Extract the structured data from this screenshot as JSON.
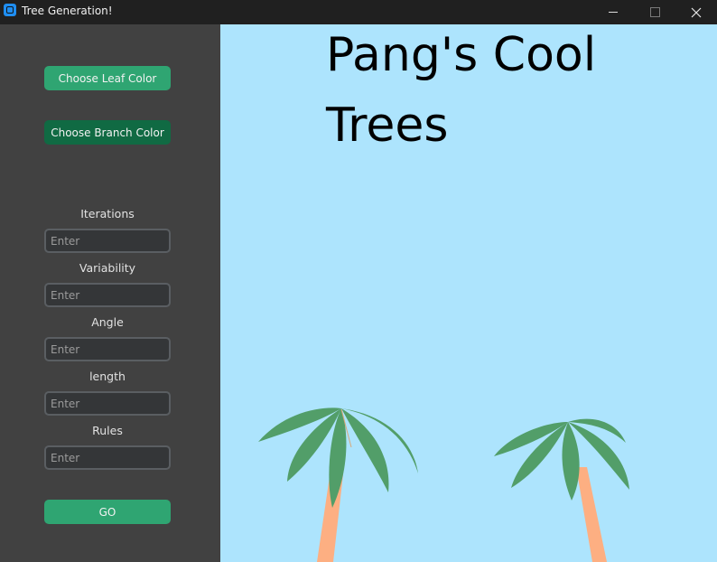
{
  "window": {
    "title": "Tree Generation!",
    "controls": {
      "minimize": "—",
      "maximize": "☐",
      "close": "✕"
    }
  },
  "sidebar": {
    "leaf_color_button": "Choose Leaf Color",
    "branch_color_button": "Choose Branch Color",
    "fields": [
      {
        "label": "Iterations",
        "placeholder": "Enter",
        "value": ""
      },
      {
        "label": "Variability",
        "placeholder": "Enter",
        "value": ""
      },
      {
        "label": "Angle",
        "placeholder": "Enter",
        "value": ""
      },
      {
        "label": "length",
        "placeholder": "Enter",
        "value": ""
      },
      {
        "label": "Rules",
        "placeholder": "Enter",
        "value": ""
      }
    ],
    "go_button": "GO"
  },
  "canvas": {
    "heading": "Pang's Cool Trees",
    "trees": [
      {
        "name": "left-palm-tree"
      },
      {
        "name": "right-palm-tree"
      }
    ]
  },
  "colors": {
    "sky": "#ade4fd",
    "leaf": "#529e69",
    "trunk": "#fdaf82",
    "sidebar": "#414141",
    "accent_button": "#2fa572",
    "dark_button": "#106a43"
  }
}
